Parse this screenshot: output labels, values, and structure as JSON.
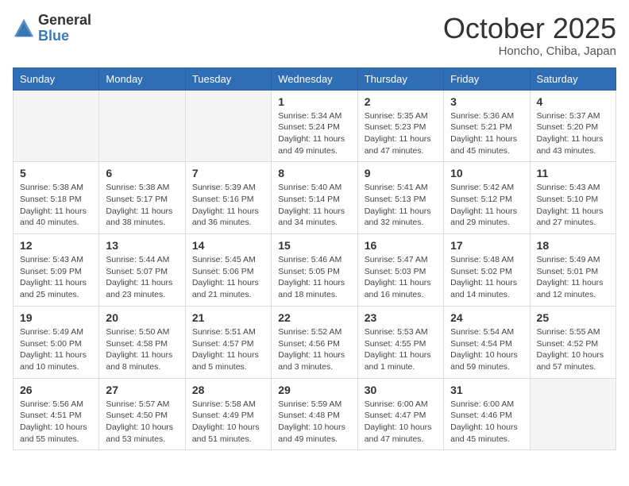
{
  "logo": {
    "general": "General",
    "blue": "Blue"
  },
  "title": "October 2025",
  "subtitle": "Honcho, Chiba, Japan",
  "weekdays": [
    "Sunday",
    "Monday",
    "Tuesday",
    "Wednesday",
    "Thursday",
    "Friday",
    "Saturday"
  ],
  "weeks": [
    [
      {
        "day": "",
        "info": ""
      },
      {
        "day": "",
        "info": ""
      },
      {
        "day": "",
        "info": ""
      },
      {
        "day": "1",
        "info": "Sunrise: 5:34 AM\nSunset: 5:24 PM\nDaylight: 11 hours\nand 49 minutes."
      },
      {
        "day": "2",
        "info": "Sunrise: 5:35 AM\nSunset: 5:23 PM\nDaylight: 11 hours\nand 47 minutes."
      },
      {
        "day": "3",
        "info": "Sunrise: 5:36 AM\nSunset: 5:21 PM\nDaylight: 11 hours\nand 45 minutes."
      },
      {
        "day": "4",
        "info": "Sunrise: 5:37 AM\nSunset: 5:20 PM\nDaylight: 11 hours\nand 43 minutes."
      }
    ],
    [
      {
        "day": "5",
        "info": "Sunrise: 5:38 AM\nSunset: 5:18 PM\nDaylight: 11 hours\nand 40 minutes."
      },
      {
        "day": "6",
        "info": "Sunrise: 5:38 AM\nSunset: 5:17 PM\nDaylight: 11 hours\nand 38 minutes."
      },
      {
        "day": "7",
        "info": "Sunrise: 5:39 AM\nSunset: 5:16 PM\nDaylight: 11 hours\nand 36 minutes."
      },
      {
        "day": "8",
        "info": "Sunrise: 5:40 AM\nSunset: 5:14 PM\nDaylight: 11 hours\nand 34 minutes."
      },
      {
        "day": "9",
        "info": "Sunrise: 5:41 AM\nSunset: 5:13 PM\nDaylight: 11 hours\nand 32 minutes."
      },
      {
        "day": "10",
        "info": "Sunrise: 5:42 AM\nSunset: 5:12 PM\nDaylight: 11 hours\nand 29 minutes."
      },
      {
        "day": "11",
        "info": "Sunrise: 5:43 AM\nSunset: 5:10 PM\nDaylight: 11 hours\nand 27 minutes."
      }
    ],
    [
      {
        "day": "12",
        "info": "Sunrise: 5:43 AM\nSunset: 5:09 PM\nDaylight: 11 hours\nand 25 minutes."
      },
      {
        "day": "13",
        "info": "Sunrise: 5:44 AM\nSunset: 5:07 PM\nDaylight: 11 hours\nand 23 minutes."
      },
      {
        "day": "14",
        "info": "Sunrise: 5:45 AM\nSunset: 5:06 PM\nDaylight: 11 hours\nand 21 minutes."
      },
      {
        "day": "15",
        "info": "Sunrise: 5:46 AM\nSunset: 5:05 PM\nDaylight: 11 hours\nand 18 minutes."
      },
      {
        "day": "16",
        "info": "Sunrise: 5:47 AM\nSunset: 5:03 PM\nDaylight: 11 hours\nand 16 minutes."
      },
      {
        "day": "17",
        "info": "Sunrise: 5:48 AM\nSunset: 5:02 PM\nDaylight: 11 hours\nand 14 minutes."
      },
      {
        "day": "18",
        "info": "Sunrise: 5:49 AM\nSunset: 5:01 PM\nDaylight: 11 hours\nand 12 minutes."
      }
    ],
    [
      {
        "day": "19",
        "info": "Sunrise: 5:49 AM\nSunset: 5:00 PM\nDaylight: 11 hours\nand 10 minutes."
      },
      {
        "day": "20",
        "info": "Sunrise: 5:50 AM\nSunset: 4:58 PM\nDaylight: 11 hours\nand 8 minutes."
      },
      {
        "day": "21",
        "info": "Sunrise: 5:51 AM\nSunset: 4:57 PM\nDaylight: 11 hours\nand 5 minutes."
      },
      {
        "day": "22",
        "info": "Sunrise: 5:52 AM\nSunset: 4:56 PM\nDaylight: 11 hours\nand 3 minutes."
      },
      {
        "day": "23",
        "info": "Sunrise: 5:53 AM\nSunset: 4:55 PM\nDaylight: 11 hours\nand 1 minute."
      },
      {
        "day": "24",
        "info": "Sunrise: 5:54 AM\nSunset: 4:54 PM\nDaylight: 10 hours\nand 59 minutes."
      },
      {
        "day": "25",
        "info": "Sunrise: 5:55 AM\nSunset: 4:52 PM\nDaylight: 10 hours\nand 57 minutes."
      }
    ],
    [
      {
        "day": "26",
        "info": "Sunrise: 5:56 AM\nSunset: 4:51 PM\nDaylight: 10 hours\nand 55 minutes."
      },
      {
        "day": "27",
        "info": "Sunrise: 5:57 AM\nSunset: 4:50 PM\nDaylight: 10 hours\nand 53 minutes."
      },
      {
        "day": "28",
        "info": "Sunrise: 5:58 AM\nSunset: 4:49 PM\nDaylight: 10 hours\nand 51 minutes."
      },
      {
        "day": "29",
        "info": "Sunrise: 5:59 AM\nSunset: 4:48 PM\nDaylight: 10 hours\nand 49 minutes."
      },
      {
        "day": "30",
        "info": "Sunrise: 6:00 AM\nSunset: 4:47 PM\nDaylight: 10 hours\nand 47 minutes."
      },
      {
        "day": "31",
        "info": "Sunrise: 6:00 AM\nSunset: 4:46 PM\nDaylight: 10 hours\nand 45 minutes."
      },
      {
        "day": "",
        "info": ""
      }
    ]
  ]
}
